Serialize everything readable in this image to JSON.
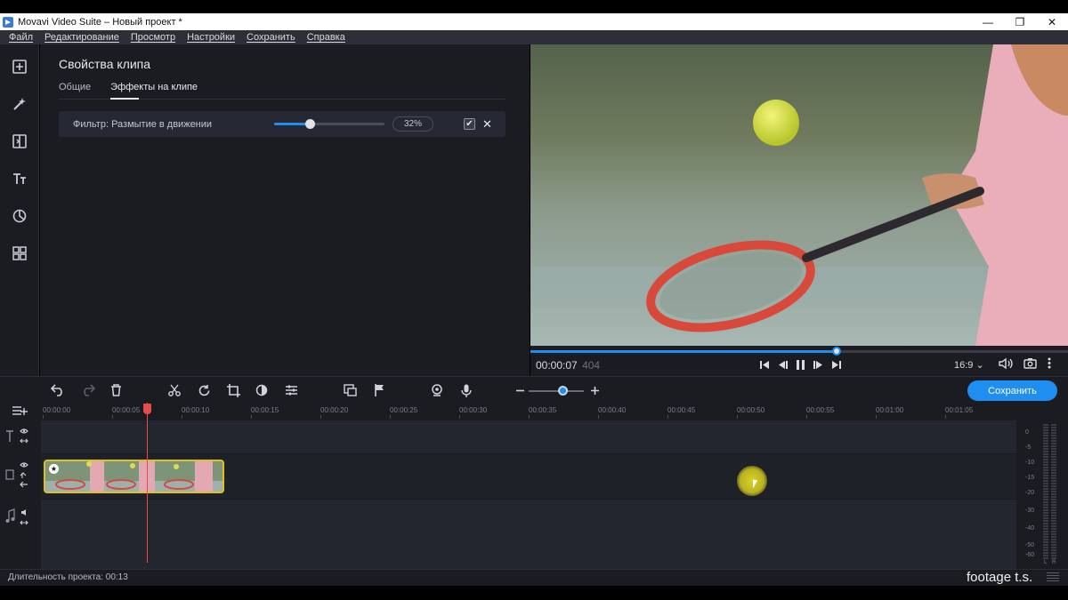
{
  "window": {
    "title": "Movavi Video Suite – Новый проект *",
    "controls": [
      "—",
      "❐",
      "✕"
    ]
  },
  "menu": [
    "Файл",
    "Редактирование",
    "Просмотр",
    "Настройки",
    "Сохранить",
    "Справка"
  ],
  "sidebar": {
    "tools": [
      "import-icon",
      "magic-wand-icon",
      "transition-icon",
      "titles-icon",
      "filters-icon",
      "more-tools-icon"
    ]
  },
  "clip_properties": {
    "heading": "Свойства клипа",
    "tabs": [
      {
        "label": "Общие",
        "active": false
      },
      {
        "label": "Эффекты на клипе",
        "active": true
      }
    ],
    "filter": {
      "label": "Фильтр: Размытие в движении",
      "value": 32,
      "value_text": "32%"
    }
  },
  "player": {
    "timecode": "00:00:07",
    "frames": "404",
    "progress": 0.57,
    "aspect": "16:9 ⌄"
  },
  "toolbar": {
    "save_label": "Сохранить",
    "zoom_level": 0.55
  },
  "timeline": {
    "ruler": [
      "00:00:00",
      "00:00:05",
      "00:00:10",
      "00:00:15",
      "00:00:20",
      "00:00:25",
      "00:00:30",
      "00:00:35",
      "00:00:40",
      "00:00:45",
      "00:00:50",
      "00:00:55",
      "00:01:00",
      "00:01:05"
    ],
    "meter_labels": [
      "0",
      "-5",
      "-10",
      "-15",
      "-20",
      "-30",
      "-40",
      "-50",
      "-60"
    ],
    "meter_channels": [
      "L",
      "R"
    ]
  },
  "status": {
    "duration": "Длительность проекта: 00:13"
  },
  "watermark": "footage t.s.",
  "colors": {
    "accent": "#1e8ef0",
    "clip_border": "#e0c21e",
    "playhead": "#e84b4b"
  }
}
